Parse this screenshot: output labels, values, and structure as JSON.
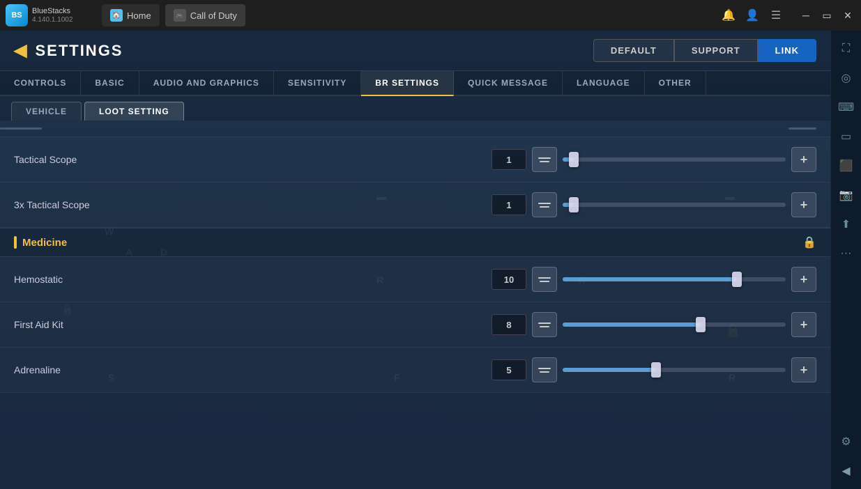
{
  "titlebar": {
    "app_name": "BlueStacks",
    "version": "4.140.1.1002",
    "home_tab": "Home",
    "game_tab": "Call of Duty"
  },
  "header": {
    "back_icon": "◀",
    "title": "SETTINGS",
    "default_btn": "DEFAULT",
    "support_btn": "SUPPORT",
    "link_btn": "LINK"
  },
  "main_tabs": [
    {
      "label": "CONTROLS",
      "active": false
    },
    {
      "label": "BASIC",
      "active": false
    },
    {
      "label": "AUDIO AND GRAPHICS",
      "active": false
    },
    {
      "label": "SENSITIVITY",
      "active": false
    },
    {
      "label": "BR SETTINGS",
      "active": true
    },
    {
      "label": "QUICK MESSAGE",
      "active": false
    },
    {
      "label": "LANGUAGE",
      "active": false
    },
    {
      "label": "OTHER",
      "active": false
    }
  ],
  "sub_tabs": [
    {
      "label": "VEHICLE",
      "active": false
    },
    {
      "label": "LOOT SETTING",
      "active": true
    }
  ],
  "settings": {
    "scopes_section": {
      "items": [
        {
          "name": "Tactical Scope",
          "value": "1",
          "fill_pct": 5
        },
        {
          "name": "3x Tactical Scope",
          "value": "1",
          "fill_pct": 5
        }
      ]
    },
    "medicine_section": {
      "label": "Medicine",
      "items": [
        {
          "name": "Hemostatic",
          "value": "10",
          "fill_pct": 78
        },
        {
          "name": "First Aid Kit",
          "value": "8",
          "fill_pct": 62
        },
        {
          "name": "Adrenaline",
          "value": "5",
          "fill_pct": 42
        }
      ]
    }
  },
  "sidebar_icons": [
    {
      "name": "expand-icon",
      "symbol": "⛶"
    },
    {
      "name": "eye-icon",
      "symbol": "◎"
    },
    {
      "name": "keyboard-icon",
      "symbol": "⌨"
    },
    {
      "name": "mobile-icon",
      "symbol": "📱"
    },
    {
      "name": "video-icon",
      "symbol": "⬛"
    },
    {
      "name": "camera-icon",
      "symbol": "📷"
    },
    {
      "name": "upload-icon",
      "symbol": "⬆"
    },
    {
      "name": "more-icon",
      "symbol": "•••"
    },
    {
      "name": "gear-icon",
      "symbol": "⚙"
    },
    {
      "name": "back-icon",
      "symbol": "◀"
    }
  ]
}
